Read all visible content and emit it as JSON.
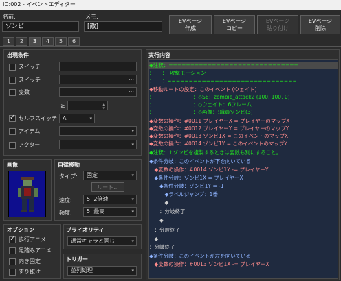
{
  "window": {
    "title": "ID:002 - イベントエディター"
  },
  "name_field": {
    "label": "名前:",
    "value": "ゾンビ"
  },
  "memo_field": {
    "label": "メモ:",
    "value": "[敵]"
  },
  "page_buttons": [
    {
      "label1": "EVページ",
      "label2": "作成"
    },
    {
      "label1": "EVページ",
      "label2": "コピー"
    },
    {
      "label1": "EVページ",
      "label2": "貼り付け"
    },
    {
      "label1": "EVページ",
      "label2": "削除"
    }
  ],
  "tabs": [
    "1",
    "2",
    "3",
    "4",
    "5",
    "6"
  ],
  "active_tab": "3",
  "conditions": {
    "title": "出現条件",
    "switch1_label": "スイッチ",
    "switch2_label": "スイッチ",
    "variable_label": "変数",
    "gte": "≥",
    "self_switch_label": "セルフスイッチ",
    "self_switch_value": "A",
    "item_label": "アイテム",
    "actor_label": "アクター",
    "dots": "..."
  },
  "image": {
    "title": "画像"
  },
  "autonomous": {
    "title": "自律移動",
    "type_label": "タイプ:",
    "type_value": "固定",
    "route_button": "ルート...",
    "speed_label": "速度:",
    "speed_value": "5: 2倍速",
    "freq_label": "頻度:",
    "freq_value": "5: 最高"
  },
  "options": {
    "title": "オプション",
    "walk": "歩行アニメ",
    "step": "足踏みアニメ",
    "dirfix": "向き固定",
    "through": "すり抜け"
  },
  "priority": {
    "title": "プライオリティ",
    "value": "通常キャラと同じ"
  },
  "trigger": {
    "title": "トリガー",
    "value": "並列処理"
  },
  "commands": {
    "title": "実行内容",
    "lines": [
      "◆注釈：==============================",
      "：　　：　攻撃モーション",
      "：　　：==============================",
      "◆移動ルートの設定：このイベント (ウェイト)",
      "：　　　　　　　　：◇SE：zombie_attack2 (100, 100, 0)",
      "：　　　　　　　　：◇ウェイト：6フレーム",
      "：　　　　　　　　：◇画像：!職員ゾンビ(3)",
      "◆変数の操作：#0011 プレイヤーX = プレイヤーのマップX",
      "◆変数の操作：#0012 プレイヤーY = プレイヤーのマップY",
      "◆変数の操作：#0013 ゾンビ1X = このイベントのマップX",
      "◆変数の操作：#0014 ゾンビ1Y = このイベントのマップY",
      "◆注釈：↑ゾンビを複製するときは変数も別にすること。",
      "◆条件分岐：このイベントが下を向いている",
      "　◆変数の操作：#0014 ゾンビ1Y -= プレイヤーY",
      "　◆条件分岐：ゾンビ1X = プレイヤーX",
      "　　◆条件分岐：ゾンビ1Y = -1",
      "　　　◆ラベルジャンプ：1番",
      "　　　◆",
      "　　：分岐終了",
      "　　◆",
      "　：分岐終了",
      "　◆",
      "：分岐終了",
      "◆条件分岐：このイベントが左を向いている",
      "　◆変数の操作：#0013 ゾンビ1X -= プレイヤーX"
    ]
  },
  "colors": {
    "command": "#ff8c8c",
    "comment": "#22e022",
    "move": "#ff8c8c",
    "branch": "#8fb4ff",
    "neutral": "#d0d0d0",
    "cmd_background": "#1f2a3f"
  }
}
